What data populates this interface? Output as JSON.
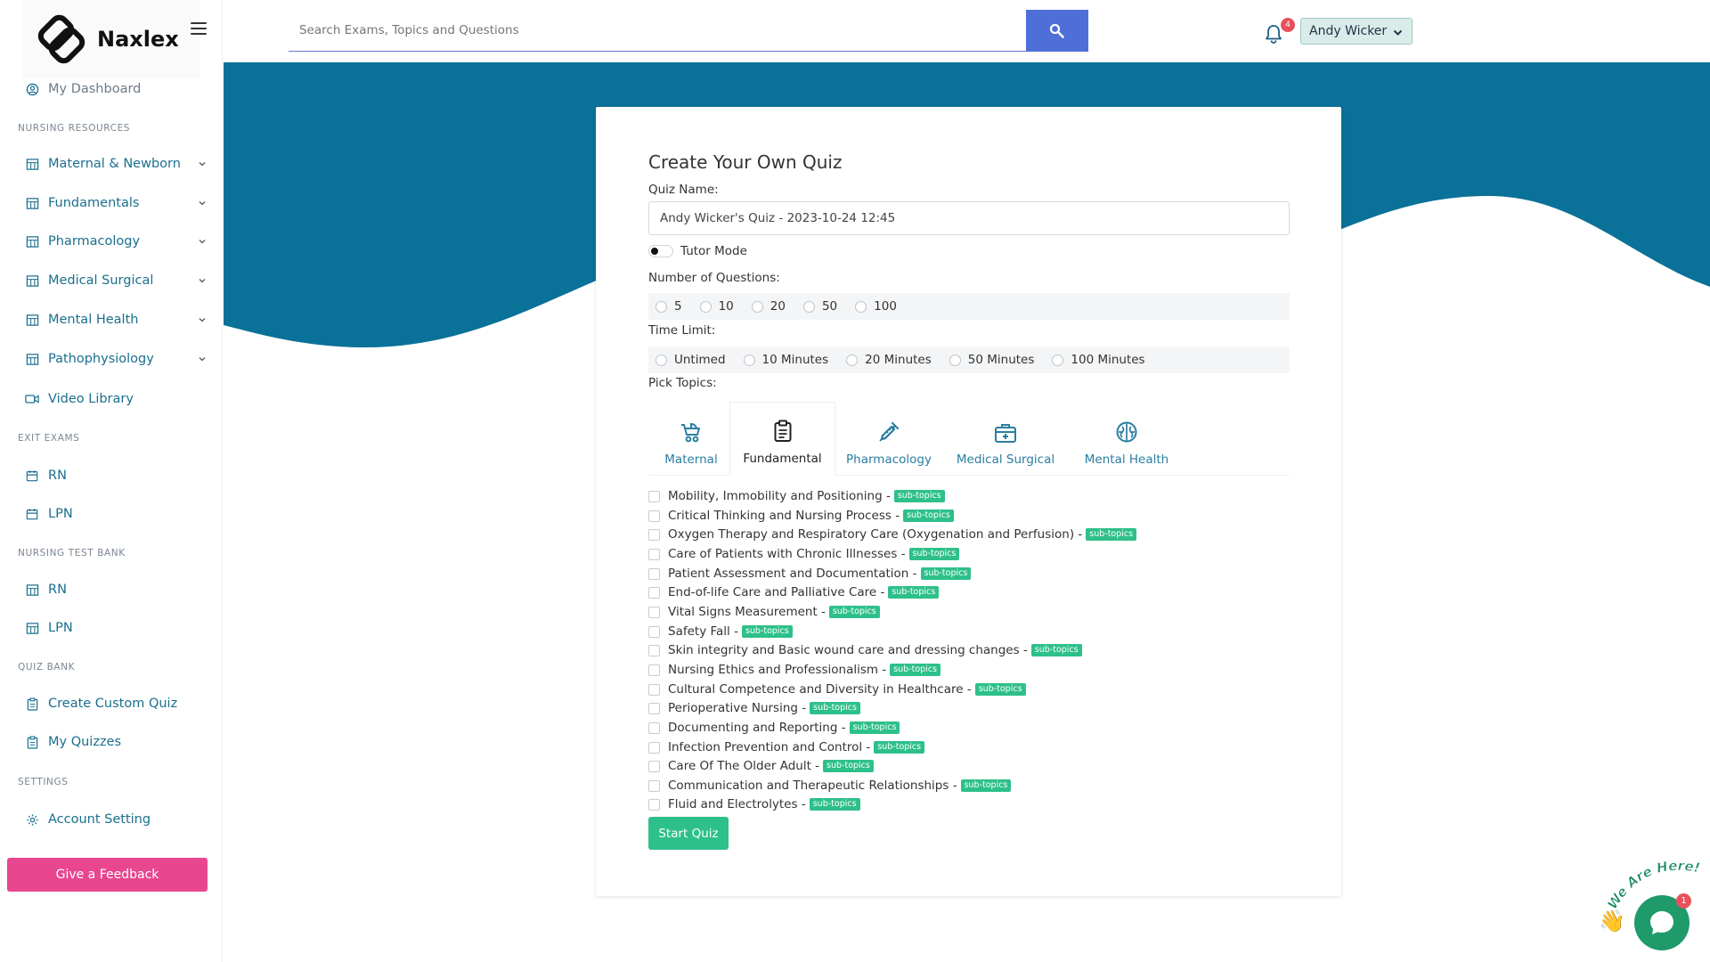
{
  "app": {
    "name": "Naxlex"
  },
  "sidebar": {
    "dashboard": "My Dashboard",
    "sections": {
      "nursing_resources": "NURSING RESOURCES",
      "exit_exams": "EXIT EXAMS",
      "nursing_test_bank": "NURSING TEST BANK",
      "quiz_bank": "QUIZ BANK",
      "settings": "SETTINGS"
    },
    "resources": [
      {
        "label": "Maternal & Newborn"
      },
      {
        "label": "Fundamentals"
      },
      {
        "label": "Pharmacology"
      },
      {
        "label": "Medical Surgical"
      },
      {
        "label": "Mental Health"
      },
      {
        "label": "Pathophysiology"
      }
    ],
    "video_library": "Video Library",
    "exit_exams": [
      "RN",
      "LPN"
    ],
    "test_bank": [
      "RN",
      "LPN"
    ],
    "quiz_bank": [
      "Create Custom Quiz",
      "My Quizzes"
    ],
    "account_setting": "Account Setting",
    "feedback": "Give a Feedback"
  },
  "header": {
    "search_placeholder": "Search Exams, Topics and Questions",
    "notifications": "4",
    "user": "Andy Wicker"
  },
  "quiz": {
    "title": "Create Your Own Quiz",
    "name_label": "Quiz Name:",
    "name_value": "Andy Wicker's Quiz - 2023-10-24 12:45",
    "tutor_mode": "Tutor Mode",
    "num_questions_label": "Number of Questions:",
    "num_questions": [
      "5",
      "10",
      "20",
      "50",
      "100"
    ],
    "time_limit_label": "Time Limit:",
    "time_limits": [
      "Untimed",
      "10 Minutes",
      "20 Minutes",
      "50 Minutes",
      "100 Minutes"
    ],
    "pick_topics_label": "Pick Topics:",
    "tabs": [
      "Maternal",
      "Fundamental",
      "Pharmacology",
      "Medical Surgical",
      "Mental Health"
    ],
    "active_tab": "Fundamental",
    "badge": "sub-topics",
    "topics": [
      "Mobility, Immobility and Positioning -",
      "Critical Thinking and Nursing Process -",
      "Oxygen Therapy and Respiratory Care (Oxygenation and Perfusion) -",
      "Care of Patients with Chronic Illnesses -",
      "Patient Assessment and Documentation -",
      "End-of-life Care and Palliative Care -",
      "Vital Signs Measurement -",
      "Safety Fall -",
      "Skin integrity and Basic wound care and dressing changes -",
      "Nursing Ethics and Professionalism -",
      "Cultural Competence and Diversity in Healthcare -",
      "Perioperative Nursing -",
      "Documenting and Reporting -",
      "Infection Prevention and Control -",
      "Care Of The Older Adult -",
      "Communication and Therapeutic Relationships -",
      "Fluid and Electrolytes -"
    ],
    "start_button": "Start Quiz"
  },
  "chat": {
    "tagline": "We Are Here!",
    "unread": "1"
  },
  "colors": {
    "teal": "#0a7199",
    "green": "#2ec08a",
    "pink": "#e8468f",
    "blue": "#4e6ed8"
  }
}
